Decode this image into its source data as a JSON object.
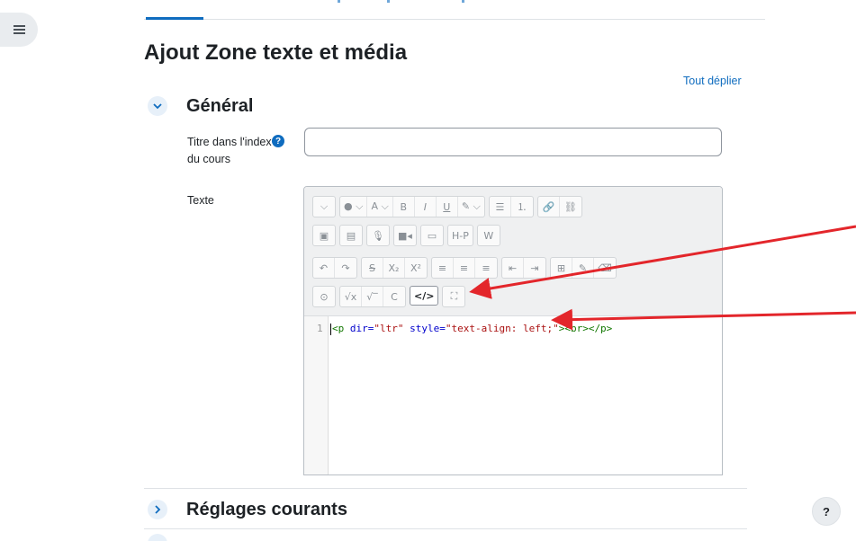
{
  "page": {
    "title": "Ajout Zone texte et média",
    "expand_all": "Tout déplier"
  },
  "section_general": {
    "toggle_icon": "chevron-down-icon",
    "title": "Général",
    "course_index_title_label_line1": "Titre dans l'index",
    "course_index_title_label_line2": "du cours",
    "course_index_title_value": "",
    "help_icon_glyph": "?",
    "text_label": "Texte"
  },
  "editor": {
    "toolbar": {
      "row1": [
        "⌵",
        "● ⌵",
        "A ⌵",
        "B",
        "I",
        "U",
        "✎ ⌵",
        "☰",
        "⒈",
        "🔗",
        "⛓"
      ],
      "row2": [
        "▣",
        "▤",
        "🎙",
        "■◂",
        "▭",
        "H-P",
        "W"
      ],
      "row3": [
        "↶",
        "↷",
        "S",
        "X₂",
        "X²",
        "≡",
        "≡",
        "≡",
        "⇤",
        "⇥",
        "⊞",
        "✎",
        "⌫"
      ],
      "row4_before": [
        "⊙",
        "√x",
        "√‾",
        "C"
      ],
      "html_button": "</>",
      "fullscreen_button": "⛶"
    },
    "code": {
      "line_number": "1",
      "tag_open": "<p",
      "attr1": " dir=",
      "val1": "\"ltr\"",
      "attr2": " style=",
      "val2": "\"text-align: left;\"",
      "tag_rest": "><br></p>"
    }
  },
  "section_common": {
    "toggle_icon": "chevron-right-icon",
    "title": "Réglages courants"
  },
  "help_button": "?",
  "colors": {
    "accent": "#0f6cbf",
    "annotation_arrow": "#e3262b"
  }
}
